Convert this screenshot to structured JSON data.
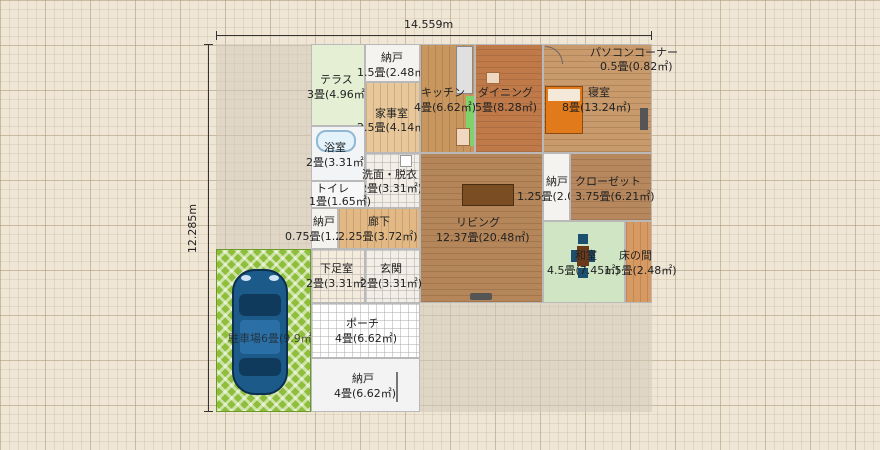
{
  "dimensions": {
    "width_label": "14.559m",
    "height_label": "12.285m"
  },
  "rooms": {
    "pc_corner": {
      "name": "パソコンコーナー",
      "area": "0.5畳(0.82㎡)"
    },
    "terrace": {
      "name": "テラス",
      "area": "3畳(4.96㎡)"
    },
    "storage_top": {
      "name": "納戸",
      "area": "1.5畳(2.48㎡)"
    },
    "kitchen": {
      "name": "キッチン",
      "area": "4畳(6.62㎡)"
    },
    "dining": {
      "name": "ダイニング",
      "area": "5畳(8.28㎡)"
    },
    "bedroom": {
      "name": "寝室",
      "area": "8畳(13.24㎡)"
    },
    "utility": {
      "name": "家事室",
      "area": "2.5畳(4.14㎡)"
    },
    "bath": {
      "name": "浴室",
      "area": "2畳(3.31㎡)"
    },
    "washroom": {
      "name": "洗面・脱衣",
      "area": "2畳(3.31㎡)"
    },
    "toilet": {
      "name": "トイレ",
      "area": "1畳(1.65㎡)"
    },
    "storage_mid": {
      "name": "納戸",
      "area": "1.25畳(2.07㎡)"
    },
    "closet": {
      "name": "クローゼット",
      "area": "3.75畳(6.21㎡)"
    },
    "storage_small": {
      "name": "納戸",
      "area": "0.75畳(1.24㎡)"
    },
    "hallway": {
      "name": "廊下",
      "area": "2.25畳(3.72㎡)"
    },
    "living": {
      "name": "リビング",
      "area": "12.37畳(20.48㎡)"
    },
    "japanese_room": {
      "name": "和室",
      "area": "4.5畳(7.45㎡)"
    },
    "tokonoma": {
      "name": "床の間",
      "area": "1.5畳(2.48㎡)"
    },
    "shoe_room": {
      "name": "下足室",
      "area": "2畳(3.31㎡)"
    },
    "entrance": {
      "name": "玄関",
      "area": "2畳(3.31㎡)"
    },
    "porch": {
      "name": "ポーチ",
      "area": "4畳(6.62㎡)"
    },
    "storage_bottom": {
      "name": "納戸",
      "area": "4畳(6.62㎡)"
    },
    "parking": {
      "name": "駐車場",
      "area": "6畳(9.9㎡)"
    }
  },
  "colors": {
    "wall_line": "#b9b9b9",
    "wood": "#b5865a",
    "tatami": "#cfe5c3",
    "grass": "#8fbf3a",
    "terrace": "#e4efd4",
    "car": "#1c5a8a"
  }
}
